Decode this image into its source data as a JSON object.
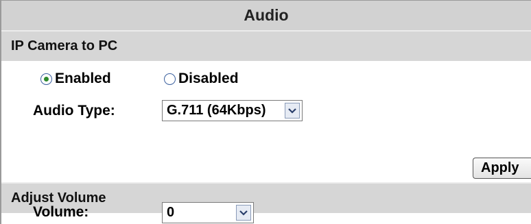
{
  "title": "Audio",
  "sections": {
    "ip_camera": {
      "header": "IP Camera to PC",
      "radio_enabled": "Enabled",
      "radio_disabled": "Disabled",
      "selected": "Enabled",
      "audio_type_label": "Audio Type:",
      "audio_type_value": "G.711 (64Kbps)",
      "apply_label": "Apply"
    },
    "adjust_volume": {
      "header": "Adjust Volume",
      "volume_label": "Volume:",
      "volume_value": "0"
    }
  },
  "icons": {
    "dropdown_arrow": "chevron-down-icon",
    "radio_selected": "radio-selected-icon",
    "radio_unselected": "radio-unselected-icon"
  },
  "colors": {
    "section_bg": "#d6d6d6",
    "radio_dot": "#2d8a2d",
    "arrow_bg": "#e6ebf4"
  }
}
